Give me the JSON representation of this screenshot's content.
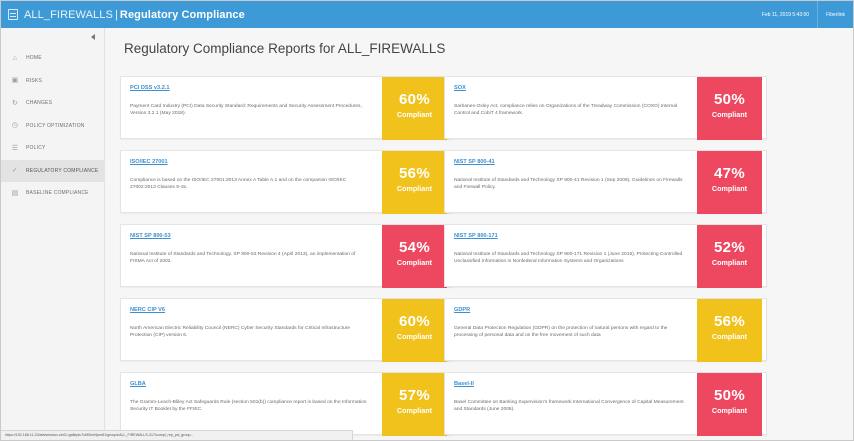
{
  "topbar": {
    "device": "ALL_FIREWALLS",
    "separator": "|",
    "section": "Regulatory Compliance",
    "datetime": "Feb 11, 2019 5:43:00",
    "user": "Fiberlink"
  },
  "sidebar": {
    "items": [
      {
        "label": "HOME",
        "icon": "home-icon",
        "glyph": "⌂"
      },
      {
        "label": "RISKS",
        "icon": "risks-icon",
        "glyph": "▣"
      },
      {
        "label": "CHANGES",
        "icon": "changes-icon",
        "glyph": "↻"
      },
      {
        "label": "POLICY OPTIMIZATION",
        "icon": "optimization-icon",
        "glyph": "◷"
      },
      {
        "label": "POLICY",
        "icon": "policy-icon",
        "glyph": "☰"
      },
      {
        "label": "REGULATORY COMPLIANCE",
        "icon": "compliance-icon",
        "glyph": "✓"
      },
      {
        "label": "BASELINE COMPLIANCE",
        "icon": "baseline-icon",
        "glyph": "▤"
      }
    ]
  },
  "main": {
    "title": "Regulatory Compliance Reports for ALL_FIREWALLS",
    "cards": [
      {
        "name": "PCI DSS v3.2.1",
        "description": "Payment Card Industry (PCI) Data Security Standard: Requirements and Security Assessment Procedures, Version 3.2.1 (May 2018).",
        "percent": "60%",
        "status": "Compliant",
        "color": "yellow"
      },
      {
        "name": "SOX",
        "description": "Sarbanes-Oxley Act, compliance relies on Organizations of the Treadway Commission (COSO) Internal Control and CobiT 4 framework.",
        "percent": "50%",
        "status": "Compliant",
        "color": "red"
      },
      {
        "name": "ISO/IEC 27001",
        "description": "Compliance is based on the ISO/IEC 27001:2013 Annex A Table A.1 and on the companion ISO/IEC 27002:2013 Clauses 9-15.",
        "percent": "56%",
        "status": "Compliant",
        "color": "yellow"
      },
      {
        "name": "NIST SP 800-41",
        "description": "National Institute of Standards and Technology SP 800-41 Revision 1 (Sep 2009), Guidelines on Firewalls and Firewall Policy.",
        "percent": "47%",
        "status": "Compliant",
        "color": "red"
      },
      {
        "name": "NIST SP 800-53",
        "description": "National Institute of Standards and Technology. SP 800-53 Revision 4 (April 2013), an implementation of FISMA Act of 2002.",
        "percent": "54%",
        "status": "Compliant",
        "color": "red"
      },
      {
        "name": "NIST SP 800-171",
        "description": "National Institute of Standards and Technology SP 800-171 Revision 1 (June 2015), Protecting Controlled Unclassified Information in Nonfederal Information Systems and Organizations",
        "percent": "52%",
        "status": "Compliant",
        "color": "red"
      },
      {
        "name": "NERC CIP V6",
        "description": "North American Electric Reliability Council (NERC) Cyber Security Standards for Critical Infrastructure Protection (CIP) version 6.",
        "percent": "60%",
        "status": "Compliant",
        "color": "yellow"
      },
      {
        "name": "GDPR",
        "description": "General Data Protection Regulation (GDPR) on the protection of natural persons with regard to the processing of personal data and on the free movement of such data",
        "percent": "56%",
        "status": "Compliant",
        "color": "yellow"
      },
      {
        "name": "GLBA",
        "description": "The Gramm-Leach-Bliley Act Safeguards Rule (section 501(b)) compliance report is based on the Information Security IT Booklet by the FFIEC.",
        "percent": "57%",
        "status": "Compliant",
        "color": "yellow"
      },
      {
        "name": "Basel-II",
        "description": "Basel Committee on Banking Supervision's framework International Convergence of Capital Measurement and Standards (June 2006).",
        "percent": "50%",
        "status": "Compliant",
        "color": "red"
      }
    ]
  },
  "statusbar": {
    "url": "https://192.168.11.23/afa/session-uinG=ga8epiu7ul90hm9pm81/groups/ALL_FIREWALLS-317/compl_rep_pci_group..."
  },
  "colors": {
    "topbar": "#3d9ad6",
    "yellow": "#f1c21b",
    "red": "#ee4860",
    "link": "#3c8fd0"
  }
}
